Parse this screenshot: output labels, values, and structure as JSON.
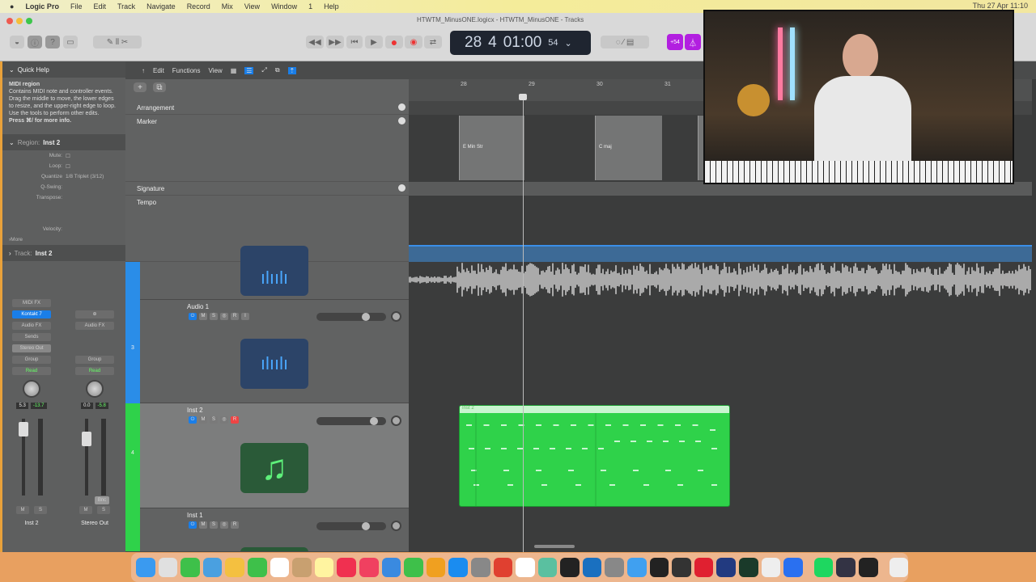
{
  "menubar": {
    "apple": "",
    "app": "Logic Pro",
    "items": [
      "File",
      "Edit",
      "Track",
      "Navigate",
      "Record",
      "Mix",
      "View",
      "Window",
      "1",
      "Help"
    ],
    "datetime": "Thu 27 Apr 11:10"
  },
  "window": {
    "title": "HTWTM_MinusONE.logicx - HTWTM_MinusONE - Tracks"
  },
  "lcd": {
    "bar": "28",
    "beat": "4",
    "time": "01:00",
    "frames": "54"
  },
  "toolbar": {
    "tempo_badge": "+54"
  },
  "tracks_header": {
    "edit": "Edit",
    "functions": "Functions",
    "view": "View"
  },
  "inspector": {
    "quick_help_title": "Quick Help",
    "quick_help_heading": "MIDI region",
    "quick_help_body": "Contains MIDI note and controller events. Drag the middle to move, the lower edges to resize, and the upper-right edge to loop. Use the tools to perform other edits.",
    "quick_help_more": "Press ⌘/ for more info.",
    "region_label": "Region:",
    "region_name": "Inst 2",
    "params": [
      {
        "k": "Mute:",
        "v": "☐"
      },
      {
        "k": "Loop:",
        "v": "☐"
      },
      {
        "k": "Quantize",
        "v": "1/8 Triplet (3/12)"
      },
      {
        "k": "Q-Swing:",
        "v": ""
      },
      {
        "k": "Transpose:",
        "v": ""
      },
      {
        "k": "",
        "v": ""
      },
      {
        "k": "",
        "v": ""
      },
      {
        "k": "Velocity:",
        "v": ""
      }
    ],
    "more": "More",
    "track_label": "Track:",
    "track_name": "Inst 2",
    "strip1": {
      "midi_fx": "MIDI FX",
      "instrument": "Kontakt 7",
      "audio_fx": "Audio FX",
      "sends": "Sends",
      "output": "Stereo Out",
      "group": "Group",
      "automation": "Read",
      "vol": "5.3",
      "peak": "-13.7",
      "mute": "M",
      "solo": "S",
      "name": "Inst 2"
    },
    "strip2": {
      "insert": "⊕",
      "audio_fx": "Audio FX",
      "group": "Group",
      "automation": "Read",
      "vol": "0.0",
      "peak": "-5.8",
      "bounce": "Bnc",
      "mute": "M",
      "solo": "S",
      "name": "Stereo Out"
    }
  },
  "global_tracks": [
    "Arrangement",
    "Marker",
    "Signature",
    "Tempo"
  ],
  "tracks": [
    {
      "name": "Audio 1",
      "number": "3",
      "color": "#2a8de8"
    },
    {
      "name": "Inst 2",
      "number": "4",
      "color": "#2fd24a"
    },
    {
      "name": "Inst 1",
      "number": "",
      "color": "#2fd24a"
    }
  ],
  "ruler": [
    "28",
    "29",
    "30",
    "31"
  ],
  "markers": [
    "E Min Str",
    "C maj"
  ],
  "midi_region": {
    "name": "Inst 2",
    "color": "#2fd24a"
  },
  "dock_icons": [
    "finder",
    "launchpad",
    "messages",
    "maps",
    "photos",
    "facetime",
    "calendar",
    "contacts",
    "notes",
    "music",
    "news",
    "keynote",
    "numbers",
    "pages",
    "app-store",
    "system-settings",
    "chrome",
    "cast",
    "maps-alt",
    "clock",
    "kodi",
    "utility",
    "ableton",
    "vnc",
    "omnisphere",
    "recorder",
    "keyboard",
    "terminal",
    "slack",
    "zoom",
    "spotify",
    "quicktime",
    "console",
    "trash"
  ]
}
